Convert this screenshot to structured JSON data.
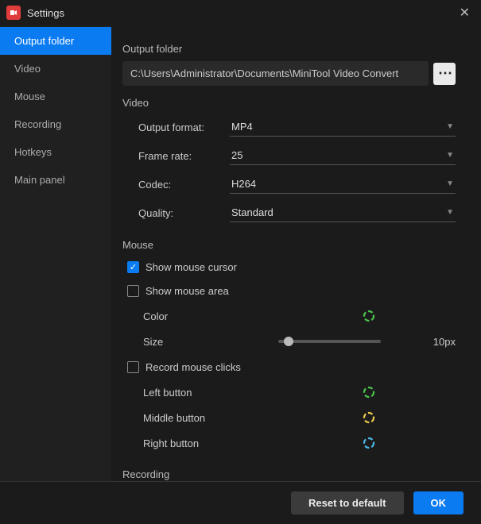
{
  "window": {
    "title": "Settings"
  },
  "sidebar": {
    "items": [
      {
        "label": "Output folder",
        "active": true
      },
      {
        "label": "Video"
      },
      {
        "label": "Mouse"
      },
      {
        "label": "Recording"
      },
      {
        "label": "Hotkeys"
      },
      {
        "label": "Main panel"
      }
    ]
  },
  "output_folder": {
    "title": "Output folder",
    "path": "C:\\Users\\Administrator\\Documents\\MiniTool Video Convert",
    "browse_dots": "⋯"
  },
  "video": {
    "title": "Video",
    "output_format_label": "Output format:",
    "output_format": "MP4",
    "frame_rate_label": "Frame rate:",
    "frame_rate": "25",
    "codec_label": "Codec:",
    "codec": "H264",
    "quality_label": "Quality:",
    "quality": "Standard"
  },
  "mouse": {
    "title": "Mouse",
    "show_cursor_label": "Show mouse cursor",
    "show_cursor": true,
    "show_area_label": "Show mouse area",
    "show_area": false,
    "color_label": "Color",
    "size_label": "Size",
    "size_value": "10px",
    "size_percent": 10,
    "record_clicks_label": "Record mouse clicks",
    "record_clicks": false,
    "left_label": "Left button",
    "middle_label": "Middle button",
    "right_label": "Right button"
  },
  "recording": {
    "title": "Recording"
  },
  "footer": {
    "reset_label": "Reset to default",
    "ok_label": "OK"
  }
}
